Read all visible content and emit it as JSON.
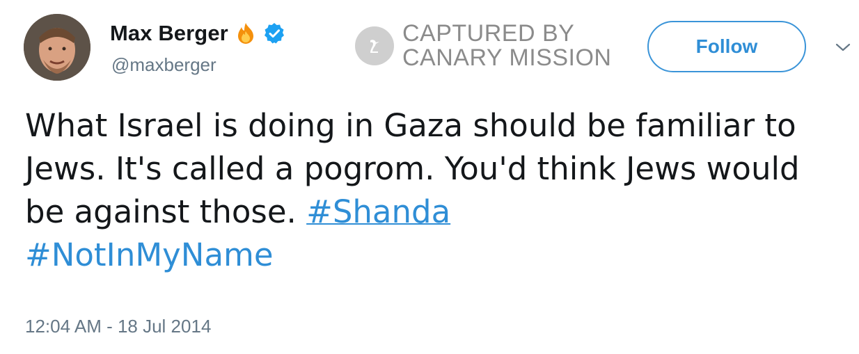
{
  "tweet": {
    "display_name": "Max Berger",
    "handle": "@maxberger",
    "watermark": {
      "line1": "CAPTURED BY",
      "line2": "CANARY MISSION",
      "icon": "canary-bird-icon"
    },
    "follow_label": "Follow",
    "text_part1": "What Israel is doing in Gaza should be familiar to Jews. It's called a pogrom. You'd think Jews would be against those. ",
    "hashtag1": "#Shanda",
    "hashtag2": "#NotInMyName",
    "timestamp": "12:04 AM - 18 Jul 2014",
    "icons": {
      "emoji": "fire-icon",
      "badge": "verified-icon",
      "menu": "chevron-down-icon"
    },
    "colors": {
      "link": "#2f8ed6",
      "muted": "#657786",
      "verified": "#1da1f2"
    }
  }
}
